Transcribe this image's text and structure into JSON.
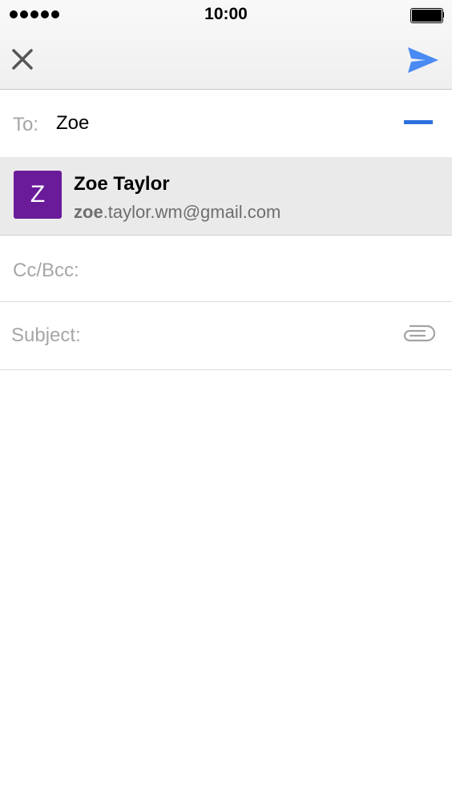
{
  "status_bar": {
    "time": "10:00",
    "signal_bars": 5,
    "battery_level": 1.0
  },
  "toolbar": {
    "close_icon": "close-icon",
    "send_icon": "send-icon",
    "accent_color": "#4a8af4"
  },
  "compose": {
    "to_label": "To:",
    "to_value": "Zoe",
    "cc_label": "Cc/Bcc:",
    "subject_label": "Subject:",
    "attach_icon": "paperclip-icon"
  },
  "suggestion": {
    "avatar_letter": "Z",
    "avatar_color": "#6a1b9a",
    "name": "Zoe Taylor",
    "email_match": "zoe",
    "email_rest": ".taylor.wm@gmail.com"
  }
}
